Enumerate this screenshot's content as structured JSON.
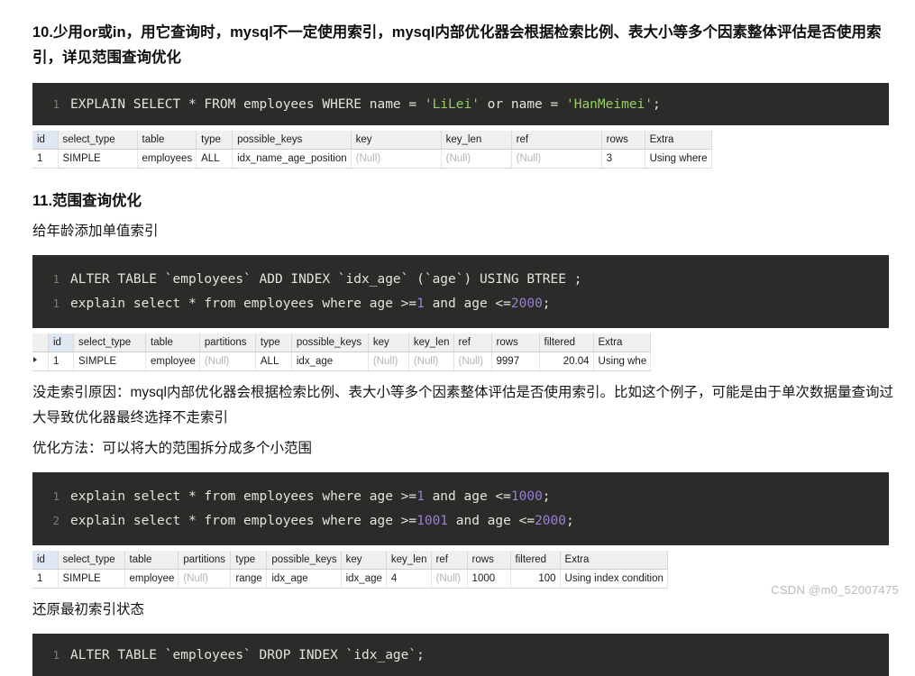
{
  "document": {
    "sections": [
      {
        "heading": "10.少用or或in，用它查询时，mysql不一定使用索引，mysql内部优化器会根据检索比例、表大小等多个因素整体评估是否使用索引，详见范围查询优化"
      },
      {
        "heading": "11.范围查询优化"
      }
    ],
    "paragraphs": {
      "add_single_index": "给年龄添加单值索引",
      "no_index_reason": "没走索引原因：mysql内部优化器会根据检索比例、表大小等多个因素整体评估是否使用索引。比如这个例子，可能是由于单次数据量查询过大导致优化器最终选择不走索引",
      "optimize_method": "优化方法：可以将大的范围拆分成多个小范围",
      "restore_index": "还原最初索引状态"
    },
    "code_blocks": {
      "explain_or": {
        "lines": [
          {
            "number": "1",
            "tokens": [
              {
                "text": "EXPLAIN SELECT * FROM employees WHERE name = ",
                "type": "plain"
              },
              {
                "text": "'LiLei'",
                "type": "string"
              },
              {
                "text": " or name = ",
                "type": "plain"
              },
              {
                "text": "'HanMeimei'",
                "type": "string"
              },
              {
                "text": ";",
                "type": "plain"
              }
            ]
          }
        ]
      },
      "add_index_and_explain": {
        "lines": [
          {
            "number": "1",
            "tokens": [
              {
                "text": "ALTER TABLE `employees` ADD INDEX `idx_age` (`age`) USING BTREE ;",
                "type": "plain"
              }
            ]
          },
          {
            "number": "1",
            "tokens": [
              {
                "text": "explain select * from employees where age >=",
                "type": "plain"
              },
              {
                "text": "1",
                "type": "number"
              },
              {
                "text": " and age <=",
                "type": "plain"
              },
              {
                "text": "2000",
                "type": "number"
              },
              {
                "text": ";",
                "type": "plain"
              }
            ]
          }
        ]
      },
      "split_range": {
        "lines": [
          {
            "number": "1",
            "tokens": [
              {
                "text": "explain select * from employees where age >=",
                "type": "plain"
              },
              {
                "text": "1",
                "type": "number"
              },
              {
                "text": " and age <=",
                "type": "plain"
              },
              {
                "text": "1000",
                "type": "number"
              },
              {
                "text": ";",
                "type": "plain"
              }
            ]
          },
          {
            "number": "2",
            "tokens": [
              {
                "text": "explain select * from employees where age >=",
                "type": "plain"
              },
              {
                "text": "1001",
                "type": "number"
              },
              {
                "text": " and age <=",
                "type": "plain"
              },
              {
                "text": "2000",
                "type": "number"
              },
              {
                "text": ";",
                "type": "plain"
              }
            ]
          }
        ]
      },
      "drop_index": {
        "lines": [
          {
            "number": "1",
            "tokens": [
              {
                "text": "ALTER TABLE `employees` DROP INDEX `idx_age`;",
                "type": "plain"
              }
            ]
          }
        ]
      }
    },
    "explain_tables": {
      "table1": {
        "columns": [
          "id",
          "select_type",
          "table",
          "type",
          "possible_keys",
          "key",
          "key_len",
          "ref",
          "rows",
          "Extra"
        ],
        "widths": [
          28,
          88,
          52,
          40,
          122,
          100,
          78,
          100,
          48,
          70
        ],
        "rows": [
          [
            {
              "value": "1"
            },
            {
              "value": "SIMPLE"
            },
            {
              "value": "employees"
            },
            {
              "value": "ALL"
            },
            {
              "value": "idx_name_age_position"
            },
            {
              "value": "(Null)",
              "null": true
            },
            {
              "value": "(Null)",
              "null": true
            },
            {
              "value": "(Null)",
              "null": true
            },
            {
              "value": "3"
            },
            {
              "value": "Using where"
            }
          ]
        ]
      },
      "table2": {
        "columns": [
          "id",
          "select_type",
          "table",
          "partitions",
          "type",
          "possible_keys",
          "key",
          "key_len",
          "ref",
          "rows",
          "filtered",
          "Extra"
        ],
        "widths": [
          28,
          80,
          55,
          62,
          40,
          85,
          45,
          48,
          42,
          53,
          60,
          52
        ],
        "marker": true,
        "rows": [
          [
            {
              "value": "1"
            },
            {
              "value": "SIMPLE"
            },
            {
              "value": "employee"
            },
            {
              "value": "(Null)",
              "null": true
            },
            {
              "value": "ALL"
            },
            {
              "value": "idx_age"
            },
            {
              "value": "(Null)",
              "null": true
            },
            {
              "value": "(Null)",
              "null": true
            },
            {
              "value": "(Null)",
              "null": true
            },
            {
              "value": "9997"
            },
            {
              "value": "20.04",
              "align": "right"
            },
            {
              "value": "Using whe"
            }
          ]
        ]
      },
      "table3": {
        "columns": [
          "id",
          "select_type",
          "table",
          "partitions",
          "type",
          "possible_keys",
          "key",
          "key_len",
          "ref",
          "rows",
          "filtered",
          "Extra"
        ],
        "widths": [
          28,
          74,
          52,
          58,
          40,
          80,
          43,
          45,
          40,
          48,
          55,
          105
        ],
        "rows": [
          [
            {
              "value": "1"
            },
            {
              "value": "SIMPLE"
            },
            {
              "value": "employee"
            },
            {
              "value": "(Null)",
              "null": true
            },
            {
              "value": "range"
            },
            {
              "value": "idx_age"
            },
            {
              "value": "idx_age"
            },
            {
              "value": "4"
            },
            {
              "value": "(Null)",
              "null": true
            },
            {
              "value": "1000"
            },
            {
              "value": "100",
              "align": "right"
            },
            {
              "value": "Using index condition"
            }
          ]
        ]
      }
    },
    "watermark": "CSDN @m0_52007475"
  }
}
